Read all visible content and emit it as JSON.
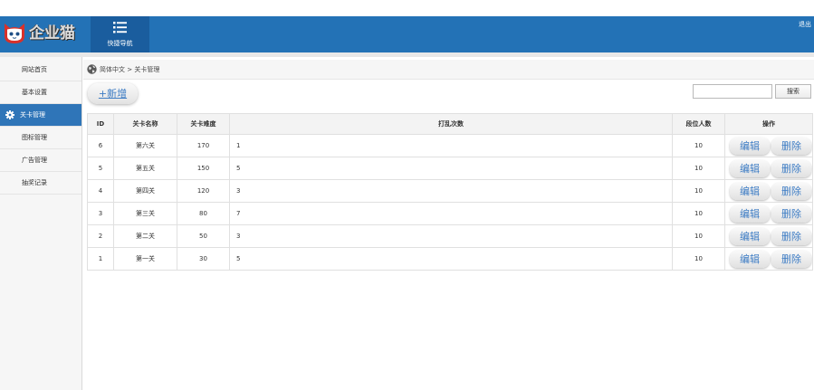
{
  "theme": {
    "header_bg": "#2372b6",
    "quick_nav_bg": "#1a5d9e",
    "active_item_bg": "#2f75b8",
    "link_color": "#3d7cc4",
    "logo_red": "#d8312a"
  },
  "header": {
    "logo_icon": "cat-logo-icon",
    "logo_text": "企业猫",
    "quick_nav_icon": "list-icon",
    "quick_nav_label": "快捷导航",
    "logout_label": "退出"
  },
  "sidebar": {
    "items": [
      {
        "label": "网站首页"
      },
      {
        "label": "基本设置"
      },
      {
        "label": "关卡管理",
        "active": true,
        "icon": "gear-icon"
      },
      {
        "label": "图标管理"
      },
      {
        "label": "广告管理"
      },
      {
        "label": "抽奖记录"
      }
    ]
  },
  "breadcrumb": {
    "icon": "globe-icon",
    "text": "简体中文 > 关卡管理"
  },
  "toolbar": {
    "add_label": "+新增",
    "search_value": "",
    "search_button_label": "搜索"
  },
  "table": {
    "columns": [
      "ID",
      "关卡名称",
      "关卡难度",
      "打乱次数",
      "段位人数",
      "操作"
    ],
    "rows": [
      {
        "id": "6",
        "name": "第六关",
        "difficulty": "170",
        "shuffle_count": "1",
        "rank_count": "10"
      },
      {
        "id": "5",
        "name": "第五关",
        "difficulty": "150",
        "shuffle_count": "5",
        "rank_count": "10"
      },
      {
        "id": "4",
        "name": "第四关",
        "difficulty": "120",
        "shuffle_count": "3",
        "rank_count": "10"
      },
      {
        "id": "3",
        "name": "第三关",
        "difficulty": "80",
        "shuffle_count": "7",
        "rank_count": "10"
      },
      {
        "id": "2",
        "name": "第二关",
        "difficulty": "50",
        "shuffle_count": "3",
        "rank_count": "10"
      },
      {
        "id": "1",
        "name": "第一关",
        "difficulty": "30",
        "shuffle_count": "5",
        "rank_count": "10"
      }
    ],
    "edit_label": "编辑",
    "delete_label": "删除"
  }
}
